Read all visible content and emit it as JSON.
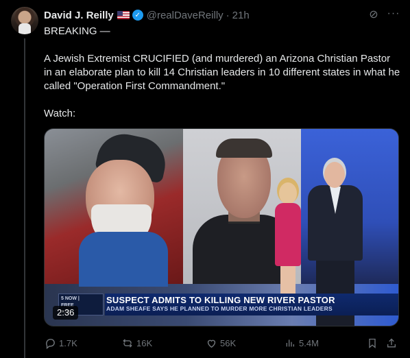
{
  "post": {
    "author_name": "David J. Reilly",
    "handle": "@realDaveReilly",
    "separator": "·",
    "time": "21h",
    "text": "BREAKING —\n\nA Jewish Extremist CRUCIFIED (and murdered) an Arizona Christian Pastor in an elaborate plan to kill 14 Christian leaders in 10 different states in what he called \"Operation First Commandment.\"\n\nWatch:",
    "badges": {
      "flag_icon": "us-flag-icon",
      "verified_icon": "verified-badge-icon",
      "verified_color": "#1d9bf0"
    }
  },
  "video": {
    "duration": "2:36",
    "lower_third_logo": "5 NOW | \nFREE\nAPP",
    "lower_third_title": "SUSPECT ADMITS TO KILLING NEW RIVER PASTOR",
    "lower_third_subtitle": "ADAM SHEAFE SAYS HE PLANNED TO MURDER MORE CHRISTIAN LEADERS"
  },
  "actions": {
    "replies": "1.7K",
    "reposts": "16K",
    "likes": "56K",
    "views": "5.4M"
  },
  "colors": {
    "background": "#000000",
    "text_primary": "#e7e9ea",
    "text_secondary": "#71767b",
    "thread_line": "#333639"
  }
}
